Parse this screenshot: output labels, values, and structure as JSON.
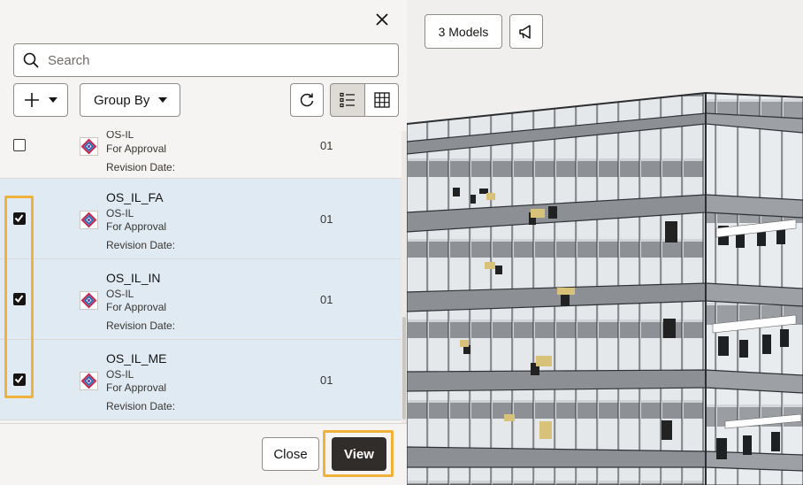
{
  "panel": {
    "search_placeholder": "Search",
    "group_by_label": "Group By"
  },
  "items": [
    {
      "name": "",
      "org": "OS-IL",
      "status": "For Approval",
      "revision": "Revision Date:",
      "version": "01",
      "checked": false
    },
    {
      "name": "OS_IL_FA",
      "org": "OS-IL",
      "status": "For Approval",
      "revision": "Revision Date:",
      "version": "01",
      "checked": true
    },
    {
      "name": "OS_IL_IN",
      "org": "OS-IL",
      "status": "For Approval",
      "revision": "Revision Date:",
      "version": "01",
      "checked": true
    },
    {
      "name": "OS_IL_ME",
      "org": "OS-IL",
      "status": "For Approval",
      "revision": "Revision Date:",
      "version": "01",
      "checked": true
    }
  ],
  "footer": {
    "close_label": "Close",
    "view_label": "View"
  },
  "viewer": {
    "models_label": "3 Models"
  },
  "icons": [
    "close-icon",
    "search-icon",
    "plus-icon",
    "caret-down-icon",
    "refresh-icon",
    "list-view-icon",
    "grid-view-icon",
    "checkbox-icon",
    "model-icon",
    "megaphone-icon"
  ],
  "colors": {
    "accent_highlight": "#f0b23a",
    "selected_row": "#dfeaf2",
    "primary_button": "#312d2a"
  }
}
